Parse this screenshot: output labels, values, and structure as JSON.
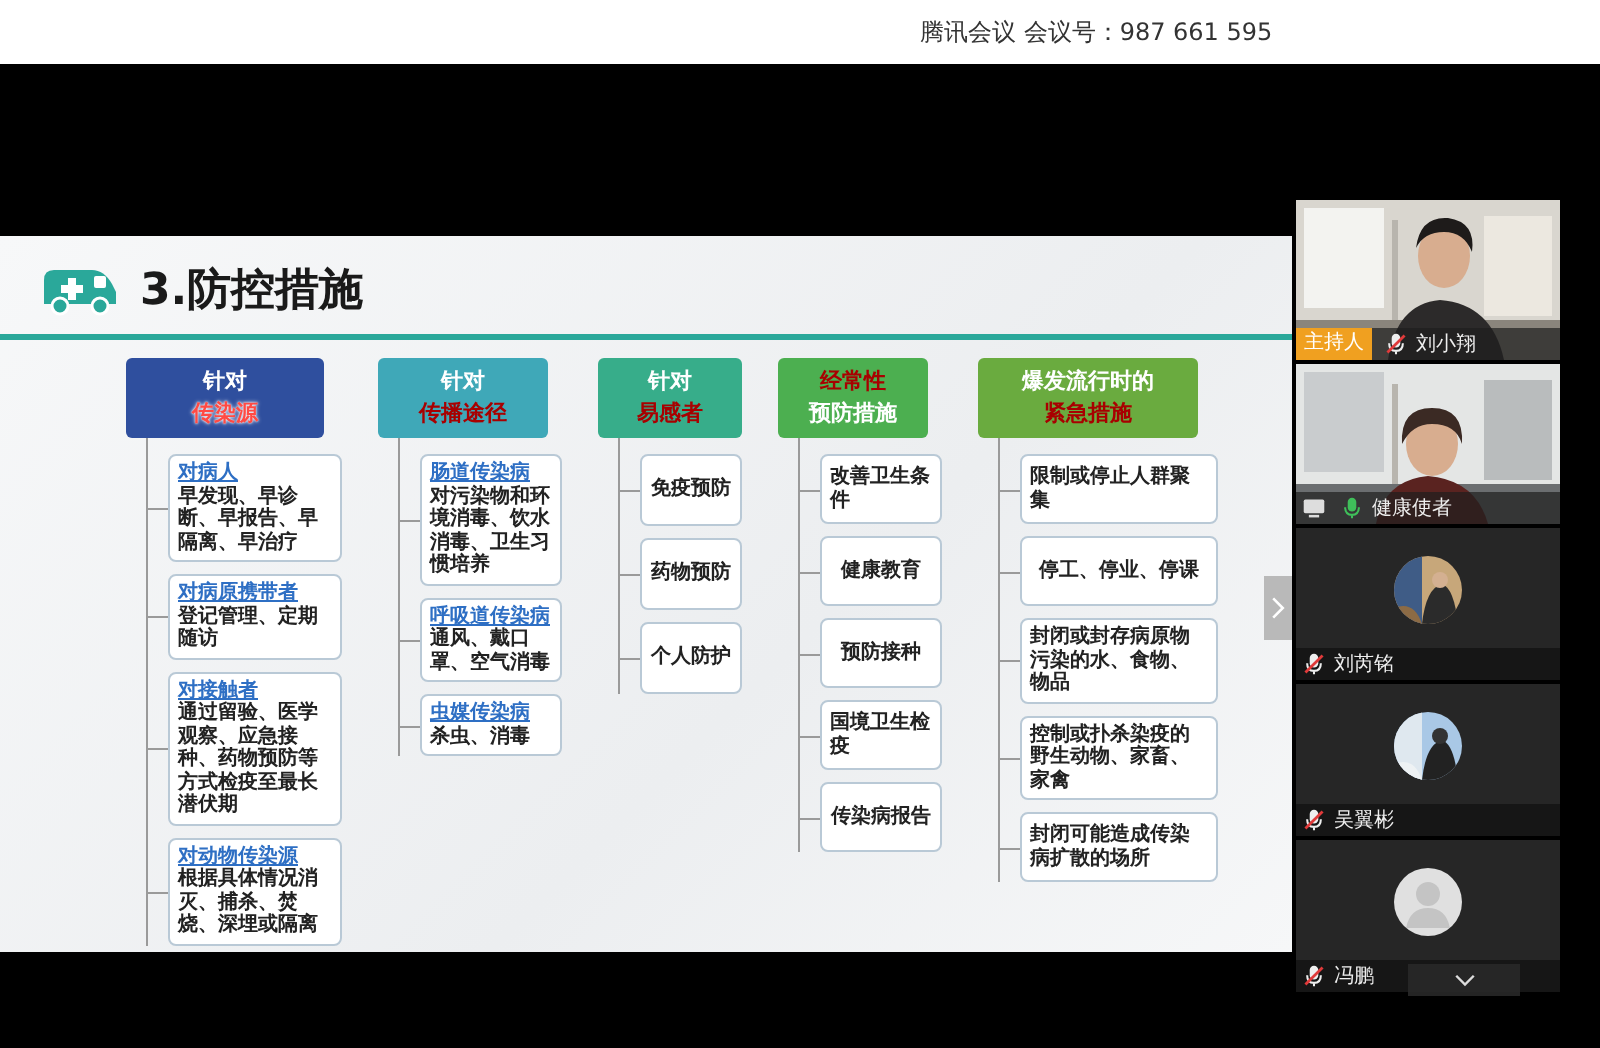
{
  "top_bar": {
    "title": "腾讯会议 会议号：987 661 595"
  },
  "slide": {
    "title": "3.防控措施",
    "columns": [
      {
        "color": "#2f4f9e",
        "header": [
          {
            "text": "针对",
            "red": false
          },
          {
            "text": "传染源",
            "red": true
          }
        ],
        "items": [
          {
            "title": "对病人",
            "text": "早发现、早诊断、早报告、早隔离、早治疗"
          },
          {
            "title": "对病原携带者",
            "text": "登记管理、定期随访"
          },
          {
            "title": "对接触者",
            "text": "通过留验、医学观察、应急接种、药物预防等方式检疫至最长潜伏期"
          },
          {
            "title": "对动物传染源",
            "text": "根据具体情况消灭、捕杀、焚烧、深埋或隔离"
          }
        ]
      },
      {
        "color": "#3fa8b8",
        "header": [
          {
            "text": "针对",
            "red": false
          },
          {
            "text": "传播途径",
            "red": true
          }
        ],
        "items": [
          {
            "title": "肠道传染病",
            "text": "对污染物和环境消毒、饮水消毒、卫生习惯培养"
          },
          {
            "title": "呼吸道传染病",
            "text": "通风、戴口罩、空气消毒"
          },
          {
            "title": "虫媒传染病",
            "text": "杀虫、消毒"
          }
        ]
      },
      {
        "color": "#37ad8a",
        "header": [
          {
            "text": "针对",
            "red": false
          },
          {
            "text": "易感者",
            "red": true
          }
        ],
        "items": [
          {
            "text": "免疫预防"
          },
          {
            "text": "药物预防"
          },
          {
            "text": "个人防护"
          }
        ]
      },
      {
        "color": "#4caf50",
        "header": [
          {
            "text": "经常性",
            "red": true
          },
          {
            "text": "预防措施",
            "red": false
          }
        ],
        "items": [
          {
            "text": "改善卫生条件"
          },
          {
            "text": "健康教育"
          },
          {
            "text": "预防接种"
          },
          {
            "text": "国境卫生检疫"
          },
          {
            "text": "传染病报告"
          }
        ]
      },
      {
        "color": "#6aab3f",
        "header": [
          {
            "text": "爆发流行时的",
            "red": false
          },
          {
            "text": "紧急措施",
            "red": true
          }
        ],
        "items": [
          {
            "text": "限制或停止人群聚集"
          },
          {
            "text": "停工、停业、停课"
          },
          {
            "text": "封闭或封存病原物污染的水、食物、物品"
          },
          {
            "text": "控制或扑杀染疫的野生动物、家畜、家禽"
          },
          {
            "text": "封闭可能造成传染病扩散的场所"
          }
        ]
      }
    ]
  },
  "participants": [
    {
      "kind": "video",
      "name": "刘小翔",
      "host_label": "主持人",
      "muted": true,
      "sharing": false
    },
    {
      "kind": "video",
      "name": "健康使者",
      "muted": false,
      "sharing": true
    },
    {
      "kind": "photo_avatar",
      "name": "刘芮铭",
      "muted": true,
      "sharing": false
    },
    {
      "kind": "photo_avatar",
      "name": "吴翼彬",
      "muted": true,
      "sharing": false
    },
    {
      "kind": "default_avatar",
      "name": "冯鹏",
      "muted": true,
      "sharing": false
    }
  ]
}
